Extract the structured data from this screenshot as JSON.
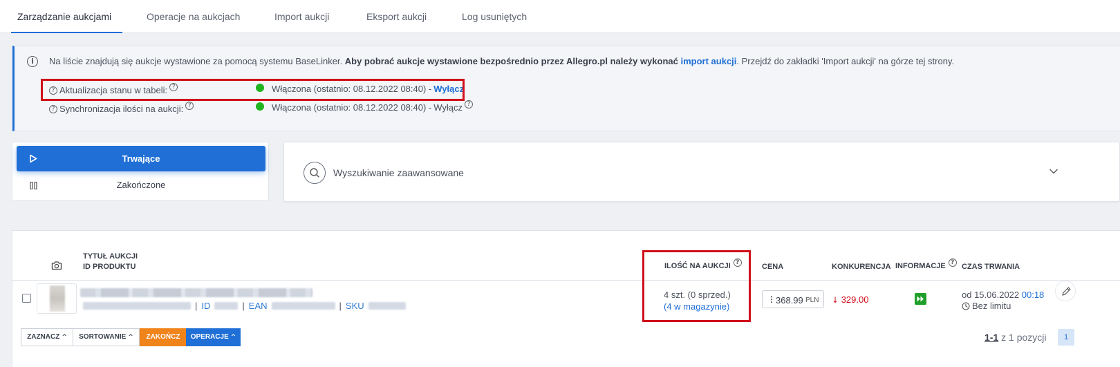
{
  "tabs": [
    {
      "label": "Zarządzanie aukcjami"
    },
    {
      "label": "Operacje na aukcjach"
    },
    {
      "label": "Import aukcji"
    },
    {
      "label": "Eksport aukcji"
    },
    {
      "label": "Log usuniętych"
    }
  ],
  "info": {
    "text_intro": "Na liście znajdują się aukcje wystawione za pomocą systemu BaseLinker. ",
    "text_bold": "Aby pobrać aukcje wystawione bezpośrednio przez Allegro.pl należy wykonać ",
    "link": "import aukcji",
    "text_tail": ". Przejdź do zakładki 'Import aukcji' na górze tej strony.",
    "rows": [
      {
        "label": "Aktualizacja stanu w tabeli:",
        "status": "Włączona (ostatnio: 08.12.2022 08:40) - ",
        "action": "Wyłącz"
      },
      {
        "label": "Synchronizacja ilości na aukcji:",
        "status": "Włączona (ostatnio: 08.12.2022 08:40) - ",
        "action": "Wyłącz"
      }
    ],
    "status_color": "#1fb41f"
  },
  "status_filter": {
    "active": "Trwające",
    "ended": "Zakończone"
  },
  "search": {
    "label": "Wyszukiwanie zaawansowane"
  },
  "table": {
    "headers": {
      "title": "Tytuł aukcji",
      "product_id": "ID produktu",
      "quantity": "Ilość na aukcji",
      "price": "Cena",
      "competition": "Konkurencja",
      "info": "Informacje",
      "duration": "Czas trwania"
    },
    "row": {
      "meta_id": "ID",
      "meta_ean": "EAN",
      "meta_sku": "SKU",
      "qty_line1": "4 szt. (0 sprzed.)",
      "qty_line2": "(4 w magazynie)",
      "price": "368.99",
      "currency": "PLN",
      "competition": "329.00",
      "duration_from": "od 15.06.2022 ",
      "duration_time": "00:18",
      "duration_limit": "Bez limitu"
    }
  },
  "bottom": {
    "select": "Zaznacz",
    "sort": "Sortowanie",
    "end": "Zakończ",
    "operations": "Operacje",
    "range": "1-1",
    "of_total": " z 1 pozycji",
    "page": "1"
  },
  "colors": {
    "accent": "#1f6fd6",
    "highlight": "#d0101a",
    "end_button": "#f0831a"
  }
}
